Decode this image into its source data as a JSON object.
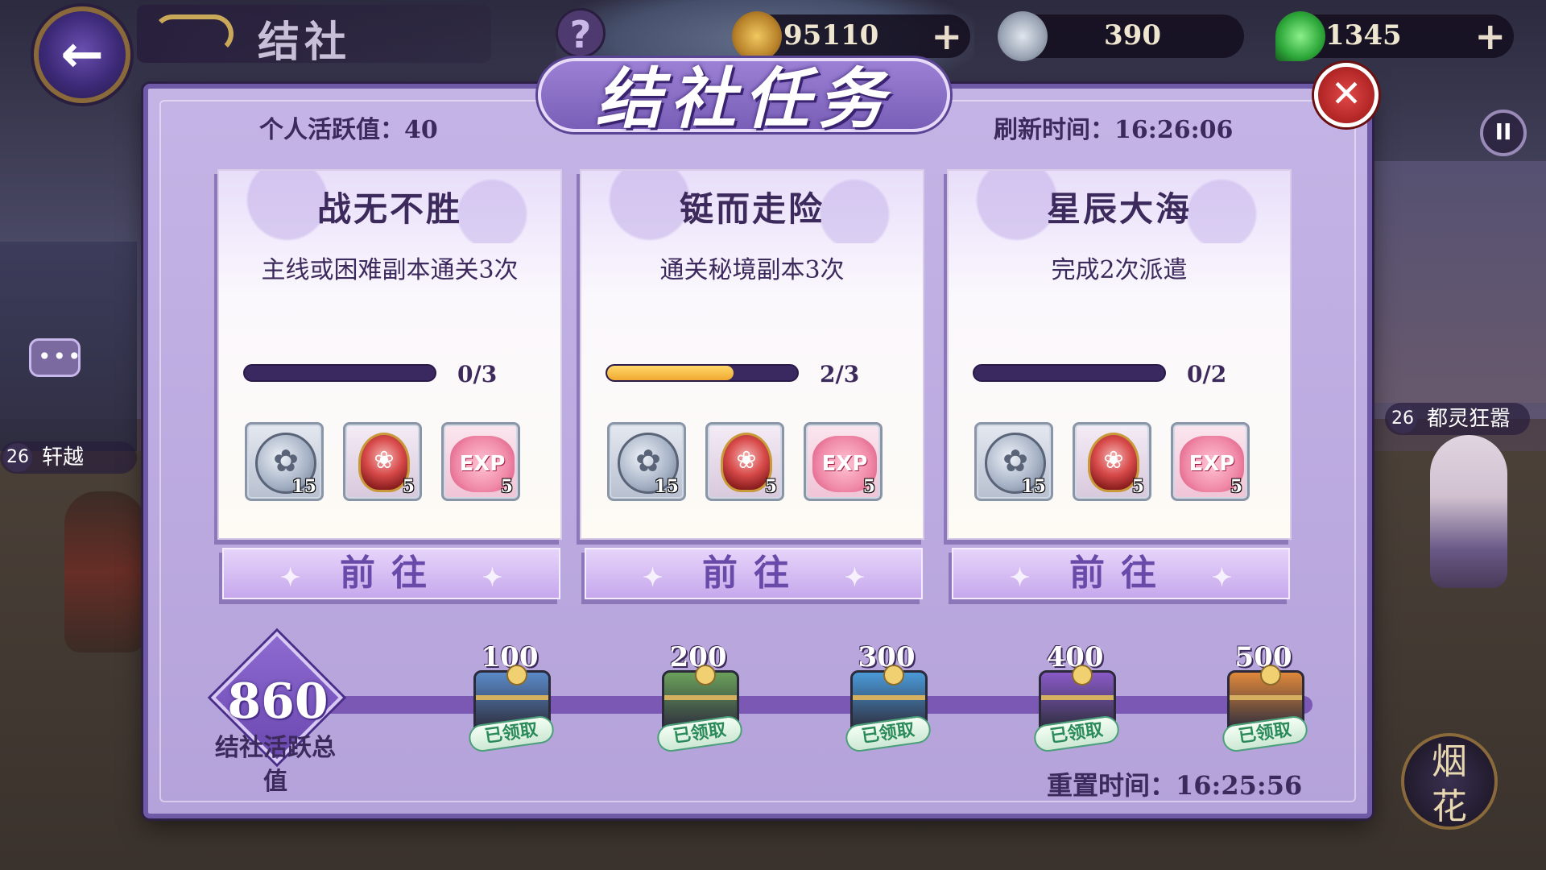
{
  "header": {
    "title": "结社",
    "back_icon": "arrow-left-icon",
    "help_label": "?"
  },
  "resources": [
    {
      "name": "gold-coin",
      "value": "95110",
      "icon": "gold-coin-icon"
    },
    {
      "name": "silver-coin",
      "value": "390",
      "icon": "silver-coin-icon"
    },
    {
      "name": "jade",
      "value": "1345",
      "icon": "jade-magatama-icon"
    }
  ],
  "panel": {
    "title": "结社任务",
    "personal_activity": "个人活跃值：40",
    "refresh_time": "刷新时间：16:26:06",
    "close_icon": "close-icon"
  },
  "tasks": [
    {
      "name": "战无不胜",
      "desc": "主线或困难副本通关3次",
      "current": 0,
      "total": 3,
      "progress_text": "0/3",
      "rewards": [
        {
          "type": "silver-coin",
          "count": "15"
        },
        {
          "type": "amulet",
          "count": "5"
        },
        {
          "type": "exp-blossom",
          "count": "5"
        }
      ],
      "button": "前往"
    },
    {
      "name": "铤而走险",
      "desc": "通关秘境副本3次",
      "current": 2,
      "total": 3,
      "progress_text": "2/3",
      "rewards": [
        {
          "type": "silver-coin",
          "count": "15"
        },
        {
          "type": "amulet",
          "count": "5"
        },
        {
          "type": "exp-blossom",
          "count": "5"
        }
      ],
      "button": "前往"
    },
    {
      "name": "星辰大海",
      "desc": "完成2次派遣",
      "current": 0,
      "total": 2,
      "progress_text": "0/2",
      "rewards": [
        {
          "type": "silver-coin",
          "count": "15"
        },
        {
          "type": "amulet",
          "count": "5"
        },
        {
          "type": "exp-blossom",
          "count": "5"
        }
      ],
      "button": "前往"
    }
  ],
  "milestones": {
    "total_value": "860",
    "total_label": "结社活跃总值",
    "items": [
      {
        "threshold": "100",
        "status": "已领取",
        "color": "#5a8ac8"
      },
      {
        "threshold": "200",
        "status": "已领取",
        "color": "#6aa05a"
      },
      {
        "threshold": "300",
        "status": "已领取",
        "color": "#4a9ad8"
      },
      {
        "threshold": "400",
        "status": "已领取",
        "color": "#8a5ac8"
      },
      {
        "threshold": "500",
        "status": "已领取",
        "color": "#e0883a"
      }
    ],
    "reset_time": "重置时间：16:25:56"
  },
  "side": {
    "left_player": {
      "level": "26",
      "name": "轩越"
    },
    "right_player": {
      "level": "26",
      "name": "都灵狂嚣"
    },
    "chat_label": "•••",
    "pause_label": "II",
    "firework_label": "烟花"
  }
}
